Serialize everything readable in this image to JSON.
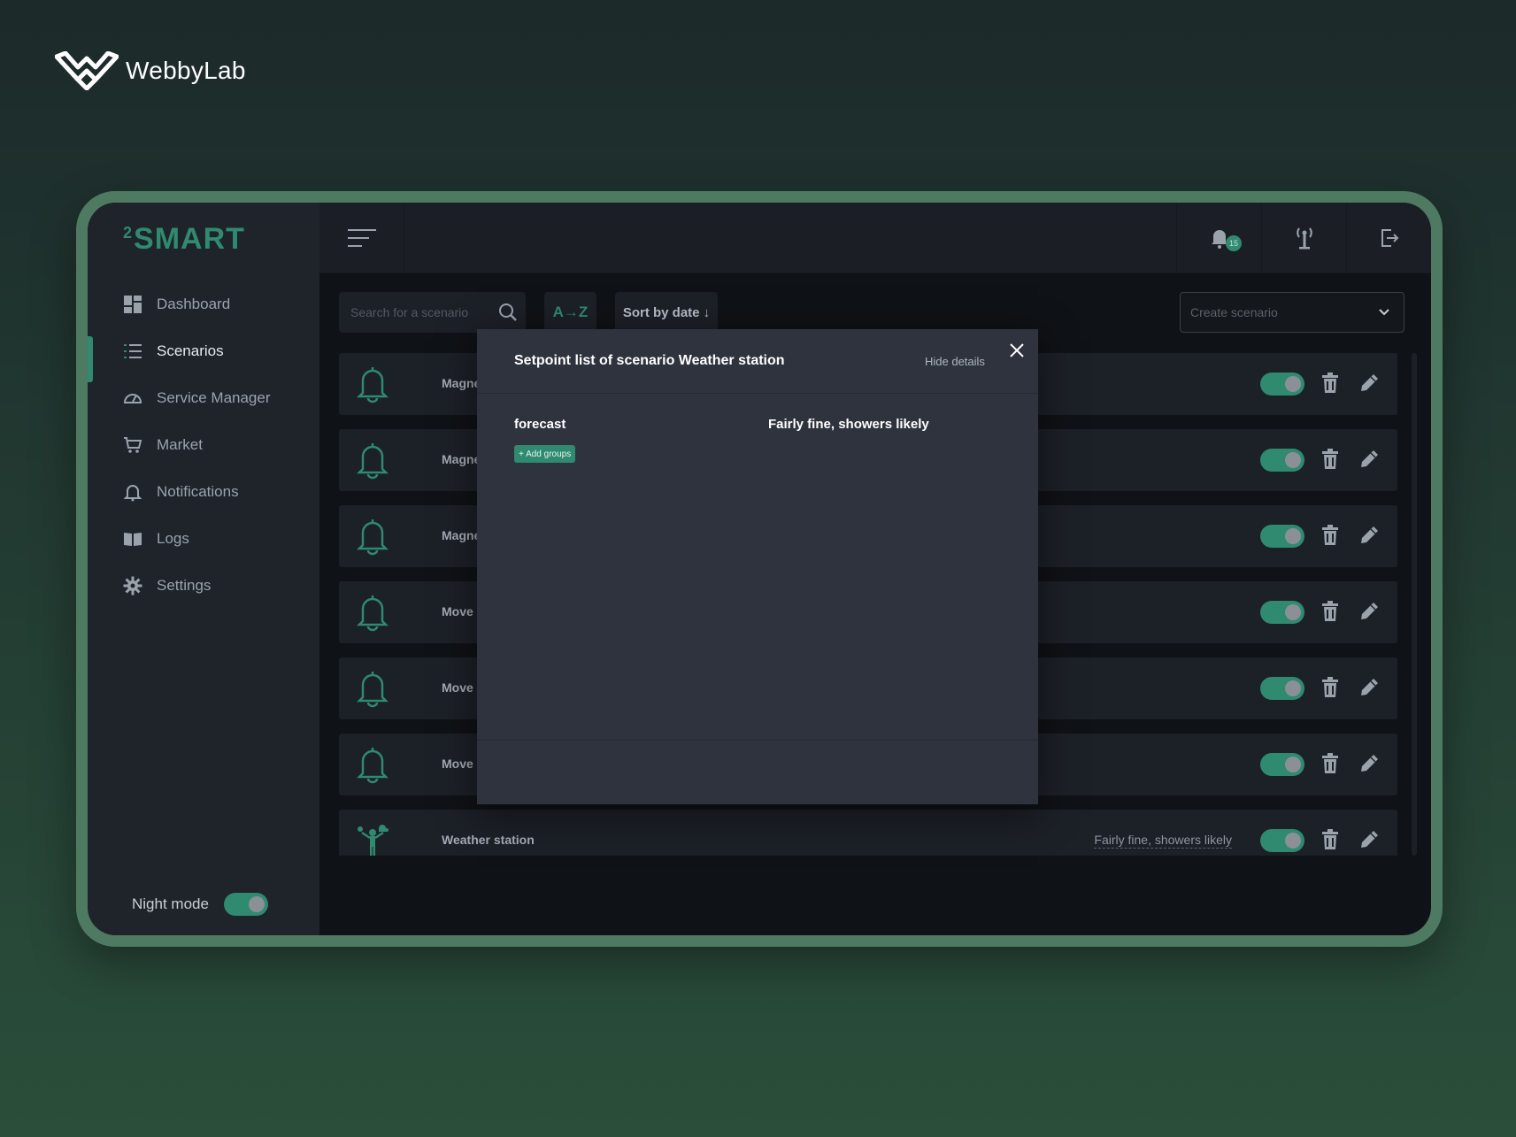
{
  "brand": {
    "name": "WebbyLab"
  },
  "app": {
    "logo_sup": "2",
    "logo_text": "SMART"
  },
  "sidebar": {
    "items": [
      {
        "label": "Dashboard",
        "icon": "dashboard-icon",
        "active": false
      },
      {
        "label": "Scenarios",
        "icon": "list-icon",
        "active": true
      },
      {
        "label": "Service Manager",
        "icon": "gauge-icon",
        "active": false
      },
      {
        "label": "Market",
        "icon": "cart-icon",
        "active": false
      },
      {
        "label": "Notifications",
        "icon": "bell-icon",
        "active": false
      },
      {
        "label": "Logs",
        "icon": "book-icon",
        "active": false
      },
      {
        "label": "Settings",
        "icon": "gear-icon",
        "active": false
      }
    ],
    "night_mode_label": "Night mode",
    "night_mode_on": true
  },
  "topbar": {
    "notification_count": "15"
  },
  "toolbar": {
    "search_placeholder": "Search for a scenario",
    "sort_alpha_label": "A→Z",
    "sort_date_label": "Sort by date ↓",
    "create_placeholder": "Create scenario"
  },
  "scenarios": [
    {
      "name": "Magne",
      "status": "",
      "icon": "bell-icon",
      "enabled": true
    },
    {
      "name": "Magne",
      "status": "",
      "icon": "bell-icon",
      "enabled": true
    },
    {
      "name": "Magne",
      "status": "",
      "icon": "bell-icon",
      "enabled": true
    },
    {
      "name": "Move l",
      "status": "",
      "icon": "bell-icon",
      "enabled": true
    },
    {
      "name": "Move l",
      "status": "",
      "icon": "bell-icon",
      "enabled": true
    },
    {
      "name": "Move l",
      "status": "",
      "icon": "bell-icon",
      "enabled": true
    },
    {
      "name": "Weather station",
      "status": "Fairly fine, showers likely",
      "icon": "weather-icon",
      "enabled": true
    }
  ],
  "modal": {
    "title": "Setpoint list of scenario Weather station",
    "hide_details": "Hide details",
    "setpoint_key": "forecast",
    "setpoint_value": "Fairly fine, showers likely",
    "add_groups": "+ Add groups"
  },
  "colors": {
    "accent": "#2f8a6f",
    "device_frame": "#4e7a62",
    "sidebar_bg": "#1f232a",
    "modal_bg": "#2e333e"
  }
}
